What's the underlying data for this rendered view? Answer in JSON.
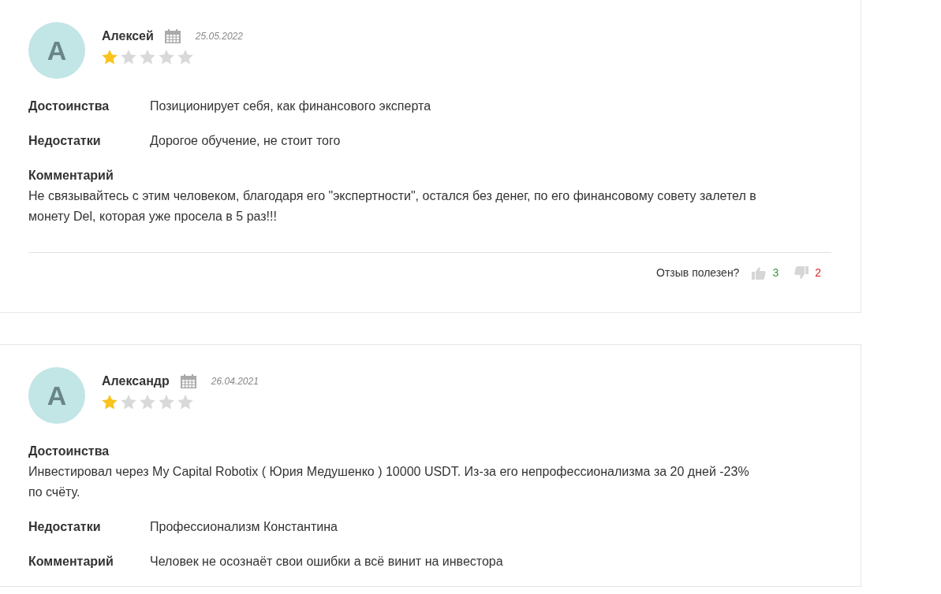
{
  "reviews": [
    {
      "avatar_letter": "А",
      "author": "Алексей",
      "date": "25.05.2022",
      "stars": 1,
      "sections": [
        {
          "kind": "inline",
          "label": "Достоинства",
          "text": "Позиционирует себя, как финансового эксперта"
        },
        {
          "kind": "inline",
          "label": "Недостатки",
          "text": "Дорогое обучение, не стоит того"
        },
        {
          "kind": "block",
          "label": "Комментарий",
          "text": "Не связывайтесь с этим человеком, благодаря его \"экспертности\", остался без денег, по его финансовому совету залетел в монету Del, которая уже просела в 5 раз!!!"
        }
      ],
      "footer": {
        "question": "Отзыв полезен?",
        "likes": "3",
        "dislikes": "2"
      }
    },
    {
      "avatar_letter": "А",
      "author": "Александр",
      "date": "26.04.2021",
      "stars": 1,
      "sections": [
        {
          "kind": "block",
          "label": "Достоинства",
          "text": "Инвестировал через My Capital Robotix ( Юрия Медушенко ) 10000 USDT. Из-за его непрофессионализма за 20 дней -23% по счёту."
        },
        {
          "kind": "inline",
          "label": "Недостатки",
          "text": "Профессионализм Константина"
        },
        {
          "kind": "inline",
          "label": "Комментарий",
          "text": "Человек не осознаёт свои ошибки а всё винит на инвестора"
        }
      ]
    }
  ]
}
